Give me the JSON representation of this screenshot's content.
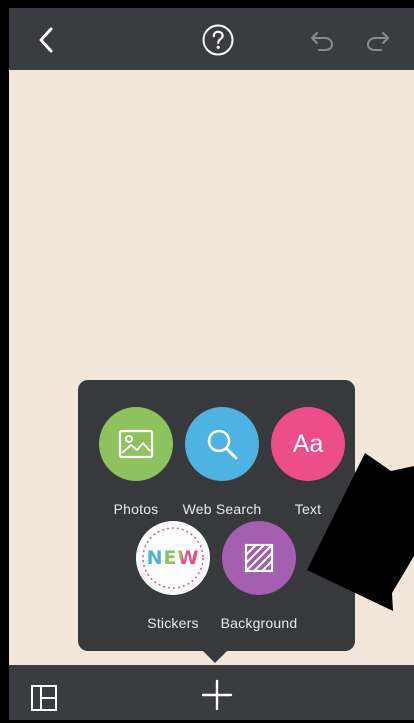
{
  "toolbar": {
    "back_icon": "chevron-left-icon",
    "help_icon": "question-circle-icon",
    "undo_icon": "undo-icon",
    "redo_icon": "redo-icon"
  },
  "menu": {
    "items": [
      {
        "label": "Photos",
        "icon": "image-icon",
        "color": "#8dc25f"
      },
      {
        "label": "Web Search",
        "icon": "search-icon",
        "color": "#4fb3e2"
      },
      {
        "label": "Text",
        "icon": "text-aa-icon",
        "icon_text": "Aa",
        "color": "#ee4d8c"
      },
      {
        "label": "Stickers",
        "icon": "new-badge-icon",
        "icon_text": "NEW",
        "color": "#ffffff"
      },
      {
        "label": "Background",
        "icon": "pattern-icon",
        "color": "#a45fb0"
      }
    ]
  },
  "bottom_bar": {
    "layout_icon": "layout-grid-icon",
    "add_icon": "plus-icon"
  },
  "colors": {
    "toolbar": "#3b3c3f",
    "canvas": "#f3e6da",
    "popup": "#38393c"
  }
}
